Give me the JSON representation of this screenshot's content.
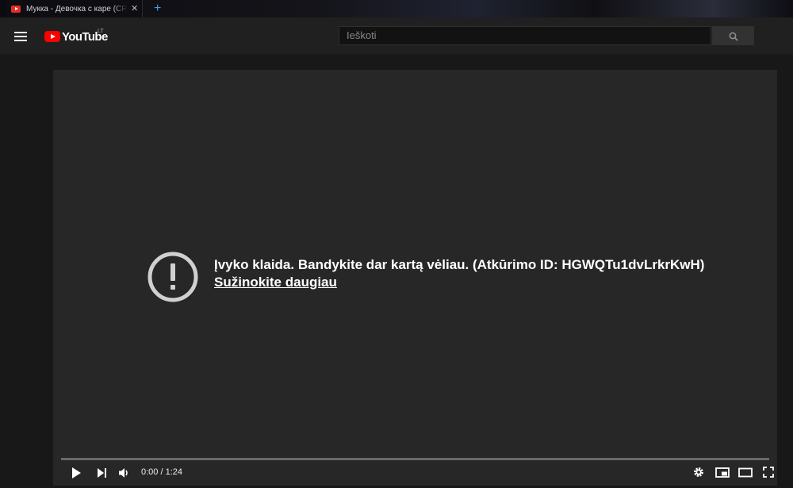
{
  "browser": {
    "tab_title": "Мукка - Девочка с каре (CRANK",
    "close_glyph": "✕",
    "new_tab_glyph": "+"
  },
  "masthead": {
    "logo_word": "YouTube",
    "country_code": "LT",
    "search_placeholder": "Ieškoti",
    "icons": [
      "menu-icon",
      "youtube-logo",
      "search-icon"
    ]
  },
  "player": {
    "error_message": "Įvyko klaida. Bandykite dar kartą vėliau. (Atkūrimo ID: HGWQTu1dvLrkrKwH)",
    "learn_more": "Sužinokite daugiau",
    "time": {
      "current": "0:00",
      "separator": " / ",
      "duration": "1:24"
    },
    "progress_fraction": 0,
    "controls": [
      "play-icon",
      "next-icon",
      "volume-icon",
      "settings-icon",
      "miniplayer-icon",
      "theater-icon",
      "fullscreen-icon"
    ]
  },
  "colors": {
    "background": "#181818",
    "masthead": "#202020",
    "player": "#272727",
    "brand_red": "#ff0000",
    "new_tab_blue": "#3d9ef5"
  }
}
